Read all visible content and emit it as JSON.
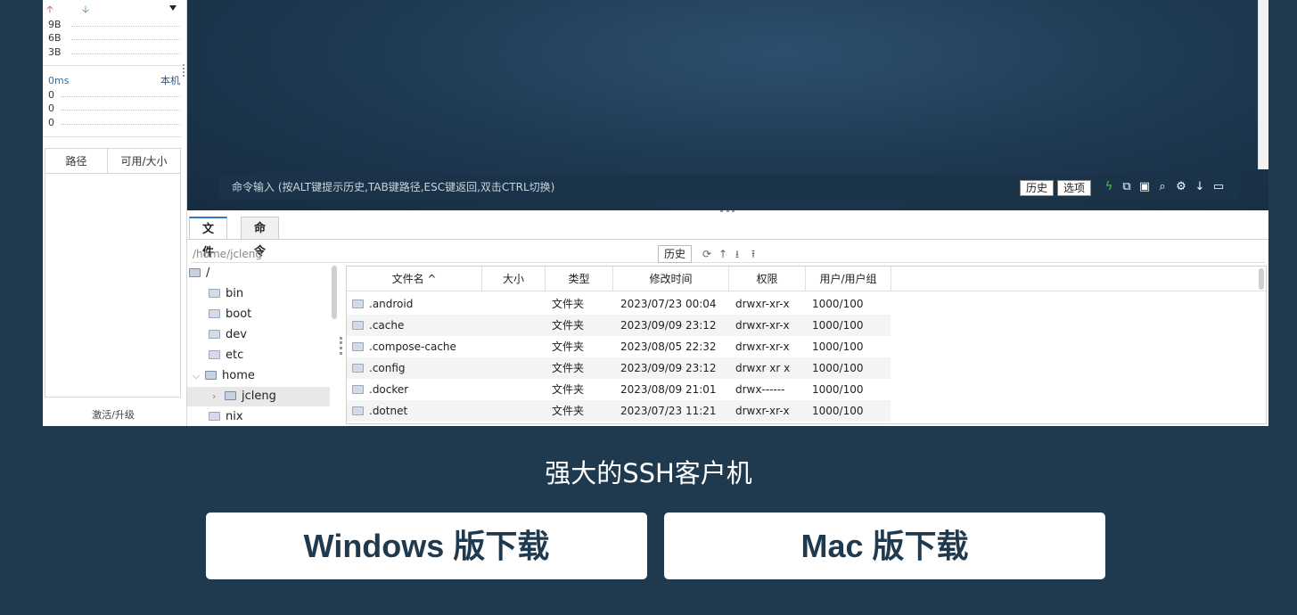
{
  "monitor": {
    "net_rows": [
      "9B",
      "6B",
      "3B"
    ],
    "ping_label": "0ms",
    "ping_target": "本机",
    "ping_rows": [
      "0",
      "0",
      "0"
    ],
    "disk_headers": [
      "路径",
      "可用/大小"
    ],
    "activate_label": "激活/升级"
  },
  "terminal": {
    "command_placeholder": "命令输入 (按ALT键提示历史,TAB键路径,ESC键返回,双击CTRL切换)",
    "history_button": "历史",
    "options_button": "选项"
  },
  "files": {
    "tabs": [
      "文件",
      "命令"
    ],
    "path": "/home/jcleng",
    "history_button": "历史",
    "tree": [
      {
        "name": "/"
      },
      {
        "name": "bin"
      },
      {
        "name": "boot"
      },
      {
        "name": "dev"
      },
      {
        "name": "etc"
      },
      {
        "name": "home"
      },
      {
        "name": "jcleng"
      },
      {
        "name": "nix"
      }
    ],
    "columns": [
      "文件名 ^",
      "大小",
      "类型",
      "修改时间",
      "权限",
      "用户/用户组"
    ],
    "rows": [
      {
        "name": ".android",
        "size": "",
        "type": "文件夹",
        "modified": "2023/07/23 00:04",
        "perm": "drwxr-xr-x",
        "owner": "1000/100"
      },
      {
        "name": ".cache",
        "size": "",
        "type": "文件夹",
        "modified": "2023/09/09 23:12",
        "perm": "drwxr-xr-x",
        "owner": "1000/100"
      },
      {
        "name": ".compose-cache",
        "size": "",
        "type": "文件夹",
        "modified": "2023/08/05 22:32",
        "perm": "drwxr-xr-x",
        "owner": "1000/100"
      },
      {
        "name": ".config",
        "size": "",
        "type": "文件夹",
        "modified": "2023/09/09 23:12",
        "perm": "drwxr xr x",
        "owner": "1000/100"
      },
      {
        "name": ".docker",
        "size": "",
        "type": "文件夹",
        "modified": "2023/08/09 21:01",
        "perm": "drwx------",
        "owner": "1000/100"
      },
      {
        "name": ".dotnet",
        "size": "",
        "type": "文件夹",
        "modified": "2023/07/23 11:21",
        "perm": "drwxr-xr-x",
        "owner": "1000/100"
      }
    ]
  },
  "tagline": "强大的SSH客户机",
  "downloads": {
    "windows": "Windows 版下载",
    "mac": "Mac 版下载"
  },
  "colors": {
    "page_bg": "#1f3a4f",
    "button_text": "#1f3a4f",
    "tab_accent": "#2b7ac9"
  }
}
